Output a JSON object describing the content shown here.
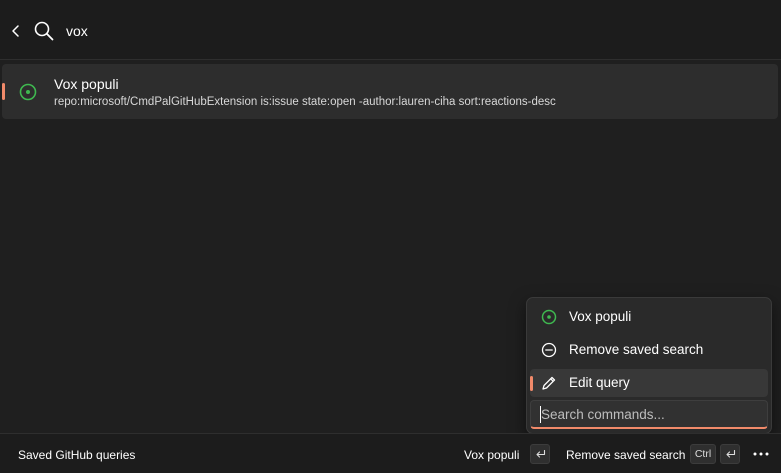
{
  "search": {
    "query": "vox",
    "back_icon": "chevron-left-icon",
    "search_icon": "search-icon"
  },
  "results": [
    {
      "title": "Vox populi",
      "subtitle": "repo:microsoft/CmdPalGitHubExtension is:issue state:open -author:lauren-ciha sort:reactions-desc",
      "icon": "issue-open-icon",
      "selected": true
    }
  ],
  "context_menu": {
    "items": [
      {
        "label": "Vox populi",
        "icon": "issue-open-icon"
      },
      {
        "label": "Remove saved search",
        "icon": "remove-circle-icon"
      },
      {
        "label": "Edit query",
        "icon": "pencil-icon",
        "active": true
      }
    ],
    "search_placeholder": "Search commands..."
  },
  "status_bar": {
    "title": "Saved GitHub queries",
    "primary_action": {
      "label": "Vox populi",
      "shortcut_icon": "enter-key-icon"
    },
    "secondary_action": {
      "label": "Remove saved search",
      "shortcut_modifier": "Ctrl",
      "shortcut_icon": "enter-key-icon"
    },
    "more_icon": "more-horizontal-icon"
  },
  "colors": {
    "accent": "#f18a6a",
    "issue_open": "#3fb950",
    "background": "#1f1f1f",
    "selected_row": "#2d2d2d"
  }
}
